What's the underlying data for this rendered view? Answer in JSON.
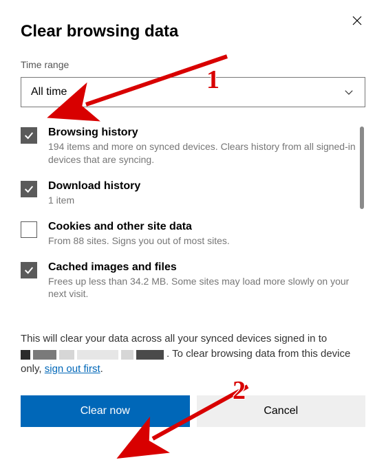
{
  "dialog": {
    "title": "Clear browsing data",
    "time_range_label": "Time range",
    "time_range_value": "All time"
  },
  "options": [
    {
      "checked": true,
      "title": "Browsing history",
      "subtitle": "194 items and more on synced devices. Clears history from all signed-in devices that are syncing."
    },
    {
      "checked": true,
      "title": "Download history",
      "subtitle": "1 item"
    },
    {
      "checked": false,
      "title": "Cookies and other site data",
      "subtitle": "From 88 sites. Signs you out of most sites."
    },
    {
      "checked": true,
      "title": "Cached images and files",
      "subtitle": "Frees up less than 34.2 MB. Some sites may load more slowly on your next visit."
    }
  ],
  "summary": {
    "part1": "This will clear your data across all your synced devices signed in to ",
    "part2": ". To clear browsing data from this device only, ",
    "link": "sign out first",
    "part3": "."
  },
  "buttons": {
    "primary": "Clear now",
    "secondary": "Cancel"
  },
  "annotations": {
    "n1": "1",
    "n2": "2"
  }
}
